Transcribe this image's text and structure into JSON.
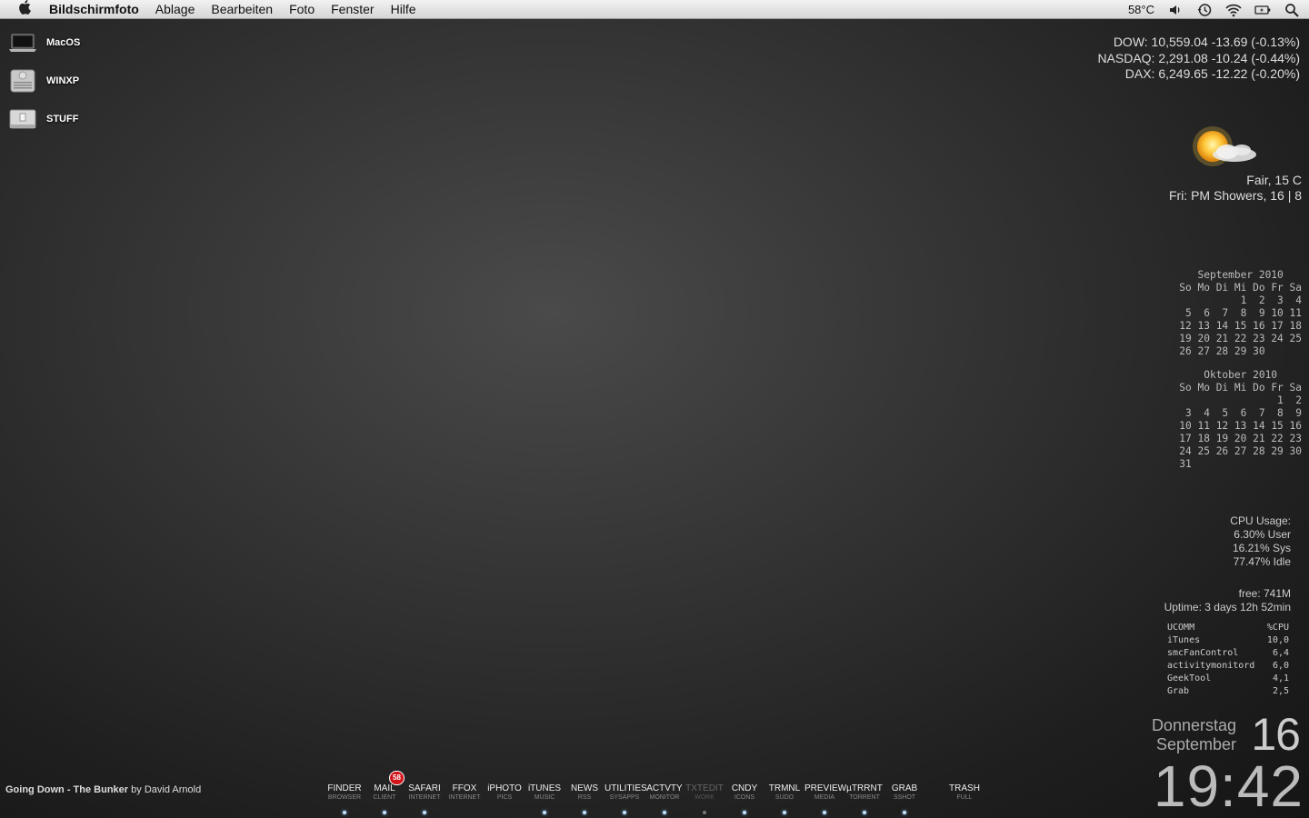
{
  "menubar": {
    "apple_icon": "apple-icon",
    "app_name": "Bildschirmfoto",
    "items": [
      "Ablage",
      "Bearbeiten",
      "Foto",
      "Fenster",
      "Hilfe"
    ],
    "temperature": "58°C",
    "status_icons": [
      "volume-icon",
      "time-machine-icon",
      "wifi-icon",
      "battery-icon",
      "spotlight-icon"
    ]
  },
  "desktop_icons": [
    {
      "label": "MacOS",
      "icon": "laptop-icon"
    },
    {
      "label": "WINXP",
      "icon": "hard-drive-icon"
    },
    {
      "label": "STUFF",
      "icon": "external-drive-icon"
    }
  ],
  "stocks": [
    "DOW: 10,559.04 -13.69 (-0.13%)",
    "NASDAQ: 2,291.08 -10.24 (-0.44%)",
    "DAX: 6,249.65 -12.22 (-0.20%)"
  ],
  "weather": {
    "icon": "sun-cloud-icon",
    "current": "Fair, 15 C",
    "forecast": "Fri: PM Showers, 16 | 8"
  },
  "calendar": [
    {
      "title": "September 2010",
      "rows": [
        "So Mo Di Mi Do Fr Sa",
        "          1  2  3  4",
        " 5  6  7  8  9 10 11",
        "12 13 14 15 16 17 18",
        "19 20 21 22 23 24 25",
        "26 27 28 29 30"
      ]
    },
    {
      "title": "Oktober 2010",
      "rows": [
        "So Mo Di Mi Do Fr Sa",
        "                1  2",
        " 3  4  5  6  7  8  9",
        "10 11 12 13 14 15 16",
        "17 18 19 20 21 22 23",
        "24 25 26 27 28 29 30",
        "31"
      ]
    }
  ],
  "cpu": [
    "CPU Usage:",
    "6.30% User",
    "16.21% Sys",
    "77.47% Idle"
  ],
  "memory": {
    "free": "free: 741M",
    "uptime": "Uptime: 3 days 12h 52min"
  },
  "processes": {
    "header": [
      "UCOMM",
      "%CPU"
    ],
    "rows": [
      [
        "iTunes",
        "10,0"
      ],
      [
        "smcFanControl",
        "6,4"
      ],
      [
        "activitymonitord",
        "6,0"
      ],
      [
        "GeekTool",
        "4,1"
      ],
      [
        "Grab",
        "2,5"
      ]
    ]
  },
  "clock": {
    "weekday": "Donnerstag",
    "month": "September",
    "day": "16",
    "time": "19:42"
  },
  "now_playing": {
    "track": "Going Down - The Bunker",
    "by": "by",
    "artist": "David Arnold"
  },
  "dock": [
    {
      "name": "FINDER",
      "sub": "BROWSER",
      "running": true
    },
    {
      "name": "MAIL",
      "sub": "CLIENT",
      "running": true,
      "badge": "58"
    },
    {
      "name": "SAFARI",
      "sub": "INTERNET",
      "running": true
    },
    {
      "name": "FFOX",
      "sub": "INTERNET",
      "running": false
    },
    {
      "name": "iPHOTO",
      "sub": "PICS",
      "running": false
    },
    {
      "name": "iTUNES",
      "sub": "MUSIC",
      "running": true
    },
    {
      "name": "NEWS",
      "sub": "RSS",
      "running": true
    },
    {
      "name": "UTILITIES",
      "sub": "SYSAPPS",
      "running": true
    },
    {
      "name": "ACTVTY",
      "sub": "MONITOR",
      "running": true
    },
    {
      "name": "TXTEDIT",
      "sub": "WORK",
      "running": true,
      "dim": true
    },
    {
      "name": "CNDY",
      "sub": "ICONS",
      "running": true
    },
    {
      "name": "TRMNL",
      "sub": "SUDO",
      "running": true
    },
    {
      "name": "PREVIEW",
      "sub": "MEDIA",
      "running": true
    },
    {
      "name": "µTRRNT",
      "sub": "TORRENT",
      "running": true
    },
    {
      "name": "GRAB",
      "sub": "SSHOT",
      "running": true
    },
    {
      "name": "TRASH",
      "sub": "FULL",
      "running": false,
      "separated": true
    }
  ]
}
